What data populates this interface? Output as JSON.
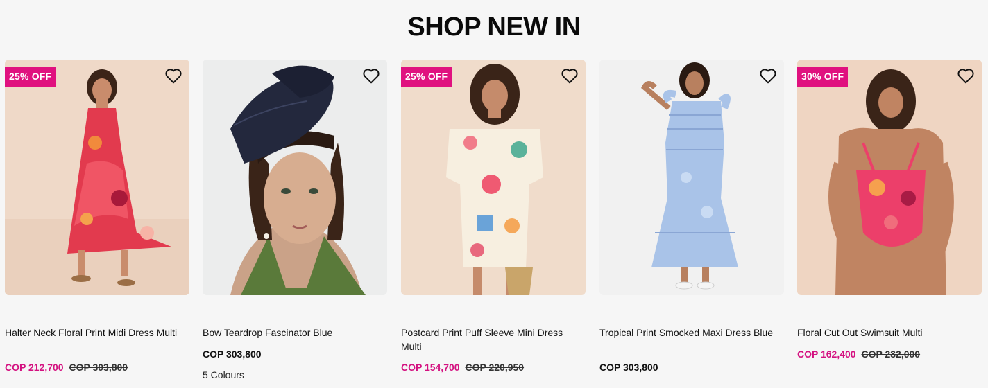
{
  "section": {
    "title": "SHOP NEW IN"
  },
  "accent": "#e0117f",
  "products": [
    {
      "badge": "25% OFF",
      "name": "Halter Neck Floral Print Midi Dress Multi",
      "sale_price": "COP 212,700",
      "original_price": "COP 303,800",
      "wishlist_icon": "heart-outline-icon"
    },
    {
      "name": "Bow Teardrop Fascinator Blue",
      "price": "COP 303,800",
      "colours": "5 Colours",
      "wishlist_icon": "heart-outline-icon"
    },
    {
      "badge": "25% OFF",
      "name": "Postcard Print Puff Sleeve Mini Dress Multi",
      "sale_price": "COP 154,700",
      "original_price": "COP 220,950",
      "wishlist_icon": "heart-outline-icon"
    },
    {
      "name": "Tropical Print Smocked Maxi Dress Blue",
      "price": "COP 303,800",
      "wishlist_icon": "heart-outline-icon"
    },
    {
      "badge": "30% OFF",
      "name": "Floral Cut Out Swimsuit Multi",
      "sale_price": "COP 162,400",
      "original_price": "COP 232,000",
      "wishlist_icon": "heart-outline-icon"
    }
  ]
}
